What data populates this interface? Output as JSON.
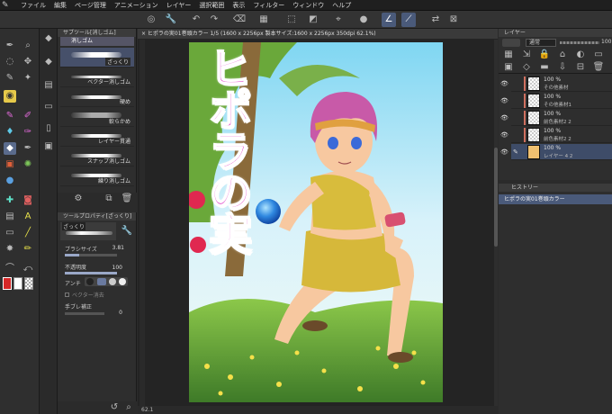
{
  "menu": [
    "ファイル",
    "編集",
    "ページ管理",
    "アニメーション",
    "レイヤー",
    "選択範囲",
    "表示",
    "フィルター",
    "ウィンドウ",
    "ヘルプ"
  ],
  "document_tab": "× ヒポラの実01巻頭カラー 1/5 (1600 x 2256px 製本サイズ:1600 x 2256px 350dpi 62.1%)",
  "subtool": {
    "title": "サブツール[消しゴム]",
    "tab_label": "消しゴム",
    "items": [
      {
        "label": "ざっくり",
        "selected": true
      },
      {
        "label": "ベクター消しゴム",
        "selected": false
      },
      {
        "label": "硬め",
        "selected": false
      },
      {
        "label": "軟らかめ",
        "selected": false
      },
      {
        "label": "レイヤー貫通",
        "selected": false
      },
      {
        "label": "スナップ消しゴム",
        "selected": false
      },
      {
        "label": "練り消しゴム",
        "selected": false
      }
    ]
  },
  "toolprop": {
    "title": "ツールプロパティ[ざっくり]",
    "preset_name": "ざっくり",
    "brush_size_label": "ブラシサイズ",
    "brush_size_value": "3.81",
    "opacity_label": "不透明度",
    "opacity_value": "100",
    "antialias_label": "アンチ",
    "vector_label": "ベクター消去",
    "stabilization_label": "手ブレ補正",
    "stabilization_value": "0"
  },
  "canvas": {
    "zoom": "62.1",
    "title_text": "ヒポラの実"
  },
  "layers": {
    "blend_mode": "通常",
    "opacity": "100",
    "rows": [
      {
        "pct": "100 %",
        "name": "その他素材",
        "selected": false
      },
      {
        "pct": "100 %",
        "name": "その他素材1",
        "selected": false
      },
      {
        "pct": "100 %",
        "name": "前色素材2 2",
        "selected": false
      },
      {
        "pct": "100 %",
        "name": "前色素材2 2",
        "selected": false
      },
      {
        "pct": "100 %",
        "name": "レイヤー 4 2",
        "selected": true
      }
    ]
  },
  "history": {
    "title": "ヒストリー",
    "items": [
      "ヒポラの実01巻頭カラー"
    ]
  },
  "colors": {
    "accent": "#4a5a7a",
    "title_magenta": "#e040c8"
  }
}
